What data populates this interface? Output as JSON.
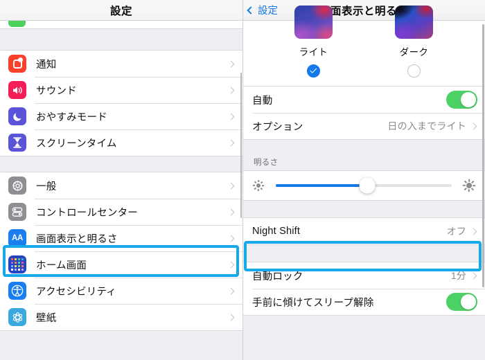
{
  "sidebar": {
    "header_title": "設定",
    "groups": [
      {
        "items": [
          {
            "label": "通知",
            "icon": "notification-icon"
          },
          {
            "label": "サウンド",
            "icon": "sound-icon"
          },
          {
            "label": "おやすみモード",
            "icon": "do-not-disturb-icon"
          },
          {
            "label": "スクリーンタイム",
            "icon": "screen-time-icon"
          }
        ]
      },
      {
        "items": [
          {
            "label": "一般",
            "icon": "general-gear-icon"
          },
          {
            "label": "コントロールセンター",
            "icon": "control-center-icon"
          },
          {
            "label": "画面表示と明るさ",
            "icon": "display-aa-icon"
          },
          {
            "label": "ホーム画面",
            "icon": "home-screen-icon"
          },
          {
            "label": "アクセシビリティ",
            "icon": "accessibility-icon"
          },
          {
            "label": "壁紙",
            "icon": "wallpaper-icon"
          }
        ]
      }
    ]
  },
  "detail": {
    "back_label": "設定",
    "title": "画面表示と明るさ",
    "appearance": {
      "light": {
        "label": "ライト",
        "selected": "true"
      },
      "dark": {
        "label": "ダーク",
        "selected": "false"
      }
    },
    "auto_row": {
      "label": "自動",
      "toggle": "on"
    },
    "options_row": {
      "label": "オプション",
      "value": "日の入までライト"
    },
    "brightness": {
      "section_label": "明るさ",
      "value_percent": "52"
    },
    "night_shift": {
      "label": "Night Shift",
      "value": "オフ"
    },
    "auto_lock": {
      "label": "自動ロック",
      "value": "1分"
    },
    "raise_to_wake": {
      "label": "手前に傾けてスリープ解除",
      "toggle": "on"
    }
  },
  "highlights": {
    "accent_color": "#16a8e8",
    "boxes": [
      "sidebar-display-row",
      "night-shift-row"
    ]
  }
}
